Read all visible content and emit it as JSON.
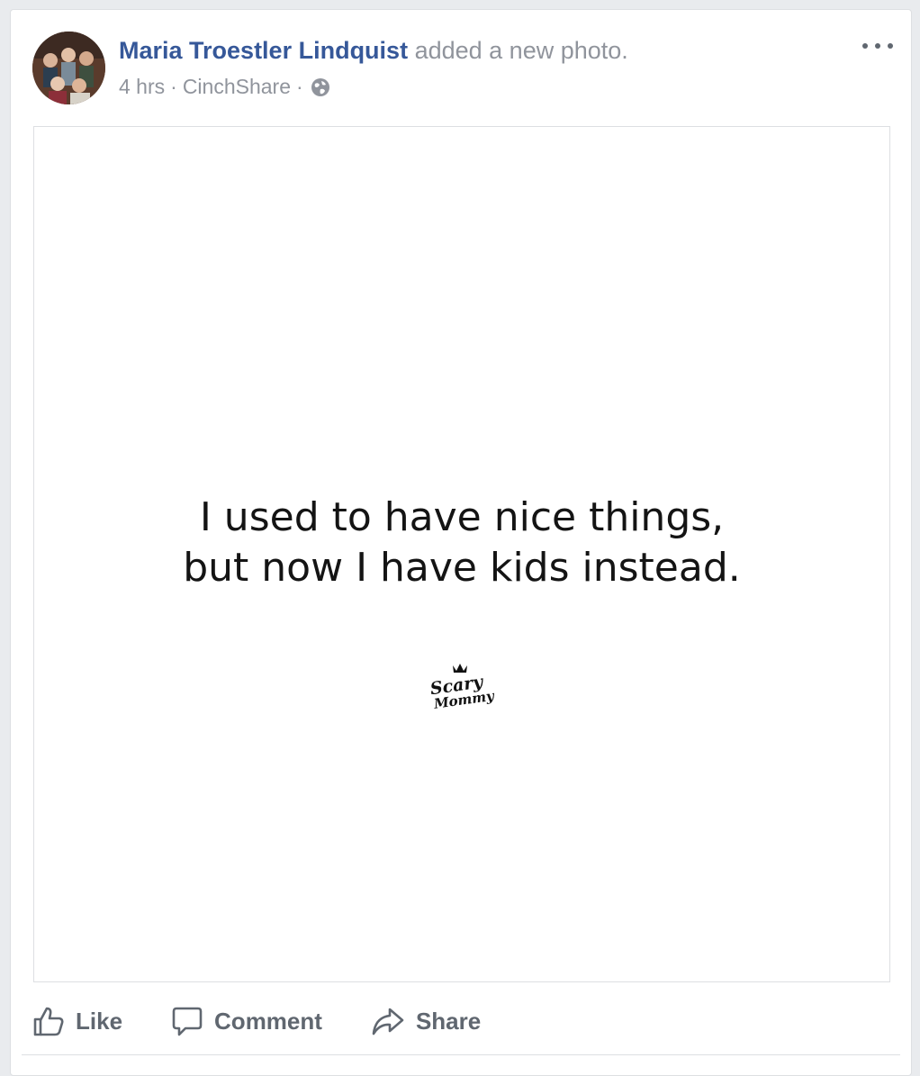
{
  "post": {
    "author": "Maria Troestler Lindquist",
    "action": "added a new photo.",
    "time": "4 hrs",
    "separator": "·",
    "app": "CinchShare",
    "privacy_icon": "globe-icon",
    "more_icon": "more-options-icon"
  },
  "photo": {
    "quote_line1": "I used to have nice things,",
    "quote_line2": "but now I have kids instead.",
    "logo_text_top": "Scary",
    "logo_text_bottom": "Mommy"
  },
  "actions": {
    "like": "Like",
    "comment": "Comment",
    "share": "Share"
  },
  "colors": {
    "author_link": "#365899",
    "meta_gray": "#90949c",
    "action_gray": "#606770",
    "background": "#e9ebee"
  }
}
